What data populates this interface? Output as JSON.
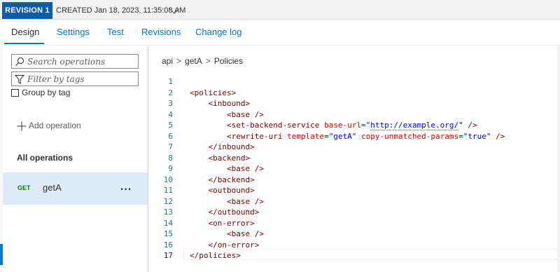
{
  "revision_bar": {
    "badge": "REVISION 1",
    "created": "CREATED Jan 18, 2023, 11:35:08 AM"
  },
  "tabs": [
    {
      "label": "Design",
      "active": true
    },
    {
      "label": "Settings",
      "active": false
    },
    {
      "label": "Test",
      "active": false
    },
    {
      "label": "Revisions",
      "active": false
    },
    {
      "label": "Change log",
      "active": false
    }
  ],
  "sidebar": {
    "search_placeholder": "Search operations",
    "filter_placeholder": "Filter by tags",
    "group_by_tag": "Group by tag",
    "add_operation": "Add operation",
    "all_operations": "All operations",
    "operations": [
      {
        "method": "GET",
        "name": "getA",
        "more": "..."
      }
    ]
  },
  "breadcrumb": {
    "items": [
      "api",
      "getA",
      "Policies"
    ],
    "separator": ">"
  },
  "editor": {
    "current_line": 17,
    "lines": [
      {
        "n": "1",
        "indent": "",
        "tag": "",
        "attrs": []
      },
      {
        "n": "2",
        "indent": "",
        "tag": "<policies>"
      },
      {
        "n": "3",
        "indent": "    ",
        "tag": "<inbound>"
      },
      {
        "n": "4",
        "indent": "        ",
        "tag": "<base />"
      },
      {
        "n": "5",
        "indent": "        ",
        "tag": "<set-backend-service base-url=\"http://example.org/\" />"
      },
      {
        "n": "6",
        "indent": "        ",
        "tag": "<rewrite-uri template=\"getA\" copy-unmatched-params=\"true\" />"
      },
      {
        "n": "7",
        "indent": "    ",
        "tag": "</inbound>"
      },
      {
        "n": "8",
        "indent": "    ",
        "tag": "<backend>"
      },
      {
        "n": "9",
        "indent": "        ",
        "tag": "<base />"
      },
      {
        "n": "10",
        "indent": "    ",
        "tag": "</backend>"
      },
      {
        "n": "11",
        "indent": "    ",
        "tag": "<outbound>"
      },
      {
        "n": "12",
        "indent": "        ",
        "tag": "<base />"
      },
      {
        "n": "13",
        "indent": "    ",
        "tag": "</outbound>"
      },
      {
        "n": "14",
        "indent": "    ",
        "tag": "<on-error>"
      },
      {
        "n": "15",
        "indent": "        ",
        "tag": "<base />"
      },
      {
        "n": "16",
        "indent": "    ",
        "tag": "</on-error>"
      },
      {
        "n": "17",
        "indent": "",
        "tag": "</policies>"
      }
    ]
  },
  "colors": {
    "accent": "#0078d4",
    "badge": "#0b5cab",
    "selected_row": "#deecf9",
    "get_method": "#107c10",
    "line_numbers": "#237893",
    "xml_tag": "#800000",
    "xml_attr": "#e50000",
    "xml_string": "#0000ff"
  }
}
